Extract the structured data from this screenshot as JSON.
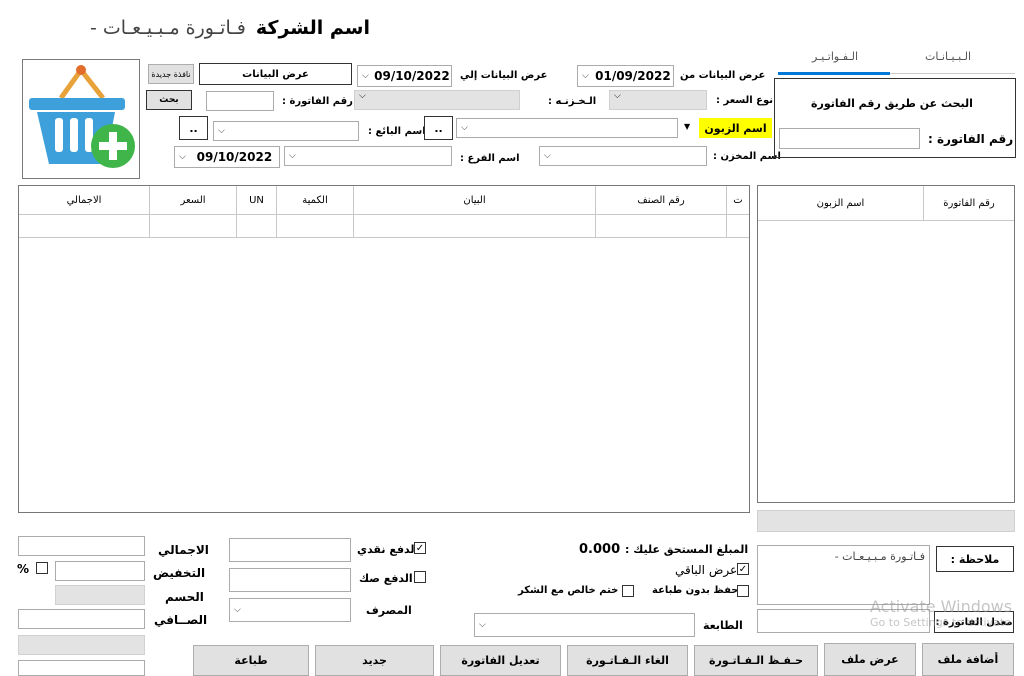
{
  "title": {
    "main": "فـاتـورة مـبـيـعـات - ",
    "company": "اسم الشركة"
  },
  "tabs": [
    {
      "label": "الـبـيـانـات"
    },
    {
      "label": "الـفـواتـيـر"
    }
  ],
  "search_panel": {
    "title": "البحث عن طريق رقم الفاتورة",
    "invoice_label": "رقم الفاتورة :"
  },
  "top": {
    "new_window": "نافذة جديدة",
    "show_data": "عرض البيانات",
    "search_btn": "بحث",
    "to_date": "09/10/2022",
    "to_label": "عرض البيانات إلي",
    "from_date": "01/09/2022",
    "from_label": "عرض البيانات من",
    "invoice_no_label": "رقم الفاتورة :",
    "treasury_label": "الـخـزنـه :",
    "price_type_label": "نوع السعر :",
    "seller_label": "اسم البائع :",
    "customer_label": "اسم الزبون",
    "dots": "..",
    "branch_label": "اسم الفرع :",
    "store_label": "اسم المخزن :",
    "invoice_date": "09/10/2022"
  },
  "grid": {
    "columns": [
      "ت",
      "رقم الصنف",
      "البيان",
      "الكمية",
      "UN",
      "السعر",
      "الاجمالي"
    ]
  },
  "side_list": {
    "columns": [
      "رقم الفاتورة",
      "اسم الزبون"
    ]
  },
  "totals": {
    "total_label": "الاجمالي",
    "discount_label": "التخفيض",
    "deduction_label": "الحسم",
    "net_label": "الصــافي",
    "percent": "%"
  },
  "payment": {
    "cash_label": "الدفع نقدي",
    "cheque_label": "الدفع صك",
    "bank_label": "المصرف",
    "due_label": "المبلغ المستحق عليك :",
    "due_value": "0.000",
    "show_rest_label": "عرض الباقي",
    "save_no_print_label": "حفظ بدون طباعة",
    "stamp_label": "ختم خالص مع الشكر",
    "printer_label": "الطابعة",
    "note_label": "ملاحظة :",
    "note_value": "فـاتـورة مـبـيـعـات -",
    "rate_label": "معدل الفاتورة :"
  },
  "buttons": [
    "أضافة ملف",
    "عرض ملف",
    "حـفـظ الـفـاتـورة",
    "الغاء الـفـاتـورة",
    "تعديل الفاتورة",
    "جديد",
    "طباعة"
  ],
  "watermark": {
    "line1": "Activate Windows",
    "line2": "Go to Settings to activate"
  },
  "colors": {
    "tab_underline": "#0078d7",
    "customer_highlight": "#ffff00",
    "basket_blue": "#3da0db",
    "plus_green": "#3fb54a"
  }
}
